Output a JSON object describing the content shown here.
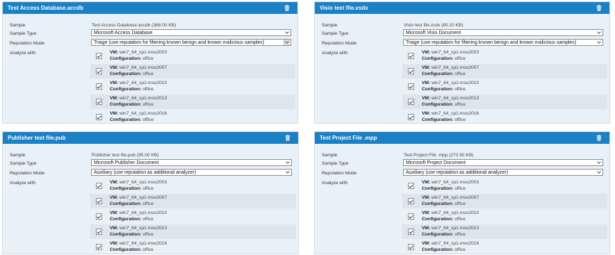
{
  "labels": {
    "sample": "Sample",
    "sample_type": "Sample Type",
    "reputation_mode": "Reputation Mode",
    "analyze_with": "Analyze with",
    "vm_prefix": "VM:",
    "config_prefix": "Configuration:"
  },
  "panels": [
    {
      "title": "Test Access Database.accdb",
      "sample": "Test Access Database.accdb (368.00 KB)",
      "sample_type": "Microsoft Access Database",
      "reputation_mode": "Triage (use reputation for filtering known benign and known malicious samples)",
      "vms": [
        {
          "vm": "win7_64_sp1-mso2003",
          "config": "office",
          "checked": true
        },
        {
          "vm": "win7_64_sp1-mso2007",
          "config": "office",
          "checked": true
        },
        {
          "vm": "win7_64_sp1-mso2010",
          "config": "office",
          "checked": true
        },
        {
          "vm": "win7_64_sp1-mso2013",
          "config": "office",
          "checked": true
        },
        {
          "vm": "win7_64_sp1-mso2016",
          "config": "office",
          "checked": true
        }
      ]
    },
    {
      "title": "Visio test file.vsdx",
      "sample": "Visio test file.vsdx (80.10 KB)",
      "sample_type": "Microsoft Visio Document",
      "reputation_mode": "Triage (use reputation for filtering known benign and known malicious samples)",
      "vms": [
        {
          "vm": "win7_64_sp1-mso2003",
          "config": "office",
          "checked": true
        },
        {
          "vm": "win7_64_sp1-mso2007",
          "config": "office",
          "checked": true
        },
        {
          "vm": "win7_64_sp1-mso2010",
          "config": "office",
          "checked": true
        },
        {
          "vm": "win7_64_sp1-mso2013",
          "config": "office",
          "checked": true
        },
        {
          "vm": "win7_64_sp1-mso2016",
          "config": "office",
          "checked": true
        }
      ]
    },
    {
      "title": "Publisher test file.pub",
      "sample": "Publisher test file.pub (95.00 KB)",
      "sample_type": "Microsoft Publisher Document",
      "reputation_mode": "Auxiliary (use reputation as additional analyzer)",
      "vms": [
        {
          "vm": "win7_64_sp1-mso2003",
          "config": "office",
          "checked": true
        },
        {
          "vm": "win7_64_sp1-mso2007",
          "config": "office",
          "checked": true
        },
        {
          "vm": "win7_64_sp1-mso2010",
          "config": "office",
          "checked": true
        },
        {
          "vm": "win7_64_sp1-mso2013",
          "config": "office",
          "checked": true
        },
        {
          "vm": "win7_64_sp1-mso2016",
          "config": "office",
          "checked": true
        }
      ]
    },
    {
      "title": "Test Project File .mpp",
      "sample": "Test Project File .mpp (272.50 KB)",
      "sample_type": "Microsoft Project Document",
      "reputation_mode": "Auxiliary (use reputation as additional analyzer)",
      "vms": [
        {
          "vm": "win7_64_sp1-mso2003",
          "config": "office",
          "checked": true
        },
        {
          "vm": "win7_64_sp1-mso2007",
          "config": "office",
          "checked": true
        },
        {
          "vm": "win7_64_sp1-mso2010",
          "config": "office",
          "checked": true
        },
        {
          "vm": "win7_64_sp1-mso2013",
          "config": "office",
          "checked": true
        },
        {
          "vm": "win7_64_sp1-mso2016",
          "config": "office",
          "checked": true
        }
      ]
    }
  ],
  "icons": {
    "delete": "trash-icon",
    "dropdown": "chevron-down-icon",
    "checkbox": "checkmark-icon"
  },
  "colors": {
    "header": "#1b80c4",
    "panel_bg": "#e9f1f8",
    "row_alt": "#dde6ee"
  }
}
